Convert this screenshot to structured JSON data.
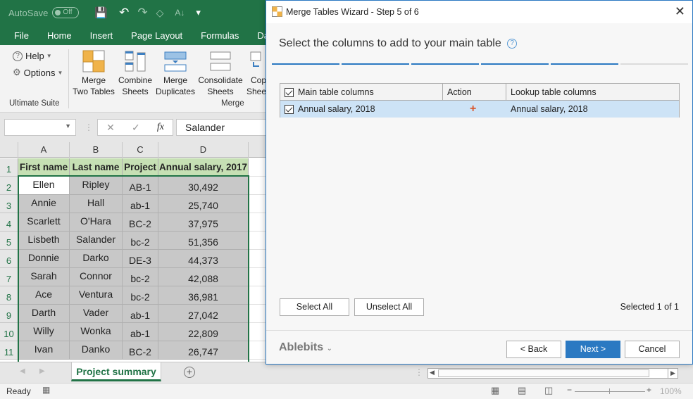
{
  "excel": {
    "qat": {
      "autosave_label": "AutoSave",
      "autosave_state": "Off"
    },
    "menu": [
      "File",
      "Home",
      "Insert",
      "Page Layout",
      "Formulas",
      "Data"
    ],
    "ribbon": {
      "help_label": "Help",
      "options_label": "Options",
      "group_ultimate": "Ultimate Suite",
      "group_merge": "Merge",
      "buttons": [
        {
          "line1": "Merge",
          "line2": "Two Tables",
          "icon": "merge-two-tables-icon"
        },
        {
          "line1": "Combine",
          "line2": "Sheets",
          "icon": "combine-sheets-icon"
        },
        {
          "line1": "Merge",
          "line2": "Duplicates",
          "icon": "merge-duplicates-icon"
        },
        {
          "line1": "Consolidate",
          "line2": "Sheets",
          "icon": "consolidate-sheets-icon"
        },
        {
          "line1": "Copy",
          "line2": "Sheets",
          "icon": "copy-sheets-icon"
        }
      ]
    },
    "formula_bar": {
      "name_box": "",
      "cancel": "✕",
      "enter": "✓",
      "fx": "fx",
      "value": "Salander"
    },
    "columns": [
      "A",
      "B",
      "C",
      "D"
    ],
    "header_row": [
      "First name",
      "Last name",
      "Project",
      "Annual salary, 2017"
    ],
    "rows": [
      [
        "Ellen",
        "Ripley",
        "AB-1",
        "30,492"
      ],
      [
        "Annie",
        "Hall",
        "ab-1",
        "25,740"
      ],
      [
        "Scarlett",
        "O'Hara",
        "BC-2",
        "37,975"
      ],
      [
        "Lisbeth",
        "Salander",
        "bc-2",
        "51,356"
      ],
      [
        "Donnie",
        "Darko",
        "DE-3",
        "44,373"
      ],
      [
        "Sarah",
        "Connor",
        "bc-2",
        "42,088"
      ],
      [
        "Ace",
        "Ventura",
        "bc-2",
        "36,981"
      ],
      [
        "Darth",
        "Vader",
        "ab-1",
        "27,042"
      ],
      [
        "Willy",
        "Wonka",
        "ab-1",
        "22,809"
      ],
      [
        "Ivan",
        "Danko",
        "BC-2",
        "26,747"
      ]
    ],
    "row_numbers": [
      "1",
      "2",
      "3",
      "4",
      "5",
      "6",
      "7",
      "8",
      "9",
      "10",
      "11"
    ],
    "sheet_tab": "Project summary",
    "status": {
      "ready": "Ready",
      "zoom": "100%"
    }
  },
  "dialog": {
    "title": "Merge Tables Wizard - Step 5 of 6",
    "heading": "Select the columns to add to your main table",
    "step_current": 5,
    "step_total": 6,
    "table": {
      "headers": [
        "Main table columns",
        "Action",
        "Lookup table columns"
      ],
      "rows": [
        {
          "main": "Annual salary, 2018",
          "action": "+",
          "lookup": "Annual salary, 2018",
          "checked": true
        }
      ]
    },
    "select_all": "Select All",
    "unselect_all": "Unselect All",
    "selected_count": "Selected 1 of 1",
    "brand": "Ablebits",
    "back": "< Back",
    "next": "Next >",
    "cancel": "Cancel",
    "accent": "#2b79c2",
    "action_color": "#d9552b"
  }
}
